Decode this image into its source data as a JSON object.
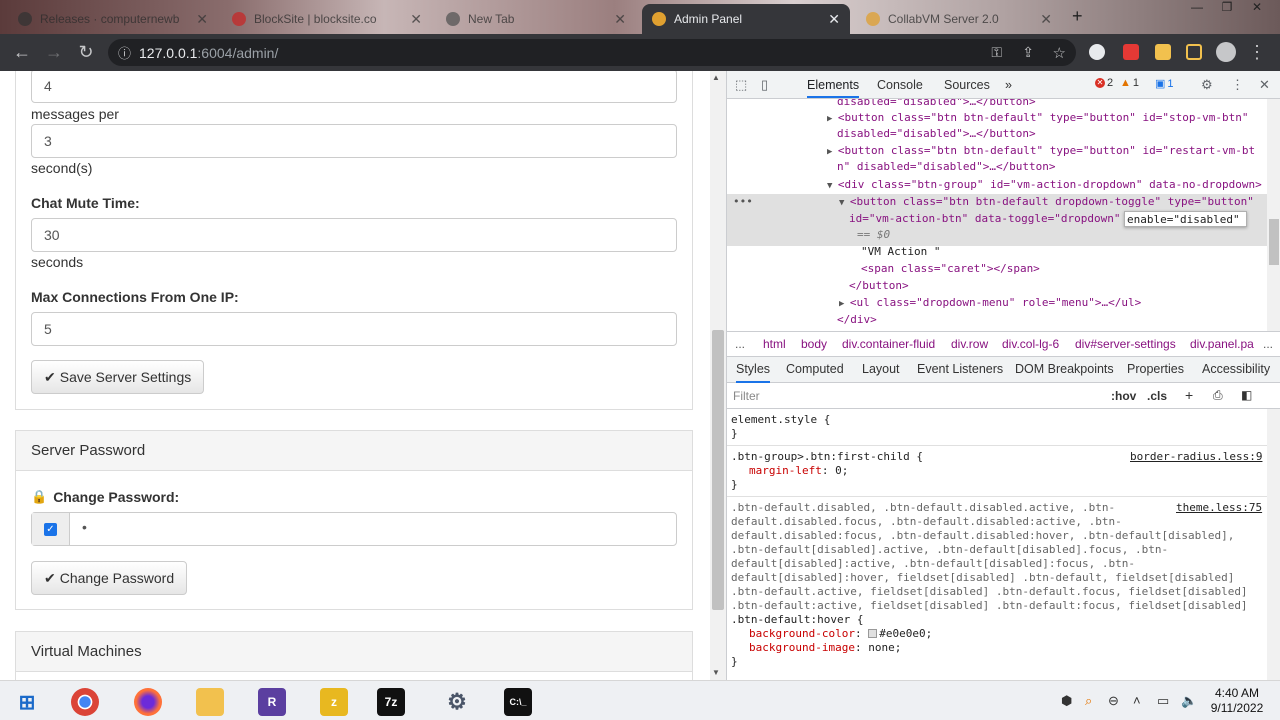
{
  "browser": {
    "tabs": [
      {
        "label": "Releases · computernewb",
        "active": false
      },
      {
        "label": "BlockSite | blocksite.co",
        "active": false
      },
      {
        "label": "New Tab",
        "active": false
      },
      {
        "label": "Admin Panel",
        "active": true
      },
      {
        "label": "CollabVM Server 2.0",
        "active": false
      }
    ],
    "new_tab": "+",
    "url_host": "127.0.0.1",
    "url_rest": ":6004/admin/"
  },
  "page": {
    "first_value": "4",
    "messages_per_label": "messages per",
    "messages_per_value": "3",
    "seconds_label_1": "second(s)",
    "chat_mute_label": "Chat Mute Time:",
    "chat_mute_value": "30",
    "seconds_label_2": "seconds",
    "max_conn_label": "Max Connections From One IP:",
    "max_conn_value": "5",
    "save_button": "Save Server Settings",
    "password_panel_title": "Server Password",
    "change_password_label": "Change Password:",
    "password_value": "•",
    "change_password_button": "Change Password",
    "vm_panel_title": "Virtual Machines"
  },
  "devtools": {
    "tabs": [
      "Elements",
      "Console",
      "Sources"
    ],
    "more": "»",
    "errors": "2",
    "warnings": "1",
    "messages": "1",
    "elements_lines": [
      {
        "t": "disabled=\"disabled\">…</button>"
      },
      {
        "t": "<button class=\"btn btn-default\" type=\"button\" id=\"stop-vm-btn\""
      },
      {
        "t": "disabled=\"disabled\">…</button>"
      },
      {
        "t": "<button class=\"btn btn-default\" type=\"button\" id=\"restart-vm-bt"
      },
      {
        "t": "n\" disabled=\"disabled\">…</button>"
      },
      {
        "t": "<div class=\"btn-group\" id=\"vm-action-dropdown\" data-no-dropdown>"
      },
      {
        "t": "<button class=\"btn btn-default dropdown-toggle\" type=\"button\""
      },
      {
        "t": "id=\"vm-action-btn\" data-toggle=\"dropdown\""
      },
      {
        "t": "== $0"
      },
      {
        "t": "\"VM Action \""
      },
      {
        "t": "<span class=\"caret\"></span>"
      },
      {
        "t": "</button>"
      },
      {
        "t": "<ul class=\"dropdown-menu\" role=\"menu\">…</ul>"
      },
      {
        "t": "</div>"
      }
    ],
    "edit_text": "enable=\"disabled\"",
    "breadcrumbs": [
      "...",
      "html",
      "body",
      "div.container-fluid",
      "div.row",
      "div.col-lg-6",
      "div#server-settings",
      "div.panel.pa",
      "..."
    ],
    "style_tabs": [
      "Styles",
      "Computed",
      "Layout",
      "Event Listeners",
      "DOM Breakpoints",
      "Properties",
      "Accessibility"
    ],
    "filter_placeholder": "Filter",
    "hov": ":hov",
    "cls": ".cls",
    "styles": {
      "element_style": "element.style {",
      "close": "}",
      "rule1_selector": ".btn-group>.btn:first-child {",
      "rule1_source": "border-radius.less:9",
      "rule1_prop": "margin-left",
      "rule1_val": "0;",
      "rule2_source": "theme.less:75",
      "rule2_selector_lines": [
        ".btn-default.disabled, .btn-default.disabled.active, .btn-",
        "default.disabled.focus, .btn-default.disabled:active, .btn-",
        "default.disabled:focus, .btn-default.disabled:hover, .btn-default[disabled],",
        ".btn-default[disabled].active, .btn-default[disabled].focus, .btn-",
        "default[disabled]:active, .btn-default[disabled]:focus, .btn-",
        "default[disabled]:hover, fieldset[disabled] .btn-default, fieldset[disabled]",
        ".btn-default.active, fieldset[disabled] .btn-default.focus, fieldset[disabled]",
        ".btn-default:active, fieldset[disabled] .btn-default:focus, fieldset[disabled]",
        ".btn-default:hover {"
      ],
      "rule2_prop1": "background-color",
      "rule2_val1": "#e0e0e0;",
      "rule2_prop2": "background-image",
      "rule2_val2": "none;"
    }
  },
  "taskbar": {
    "time": "4:40 AM",
    "date": "9/11/2022"
  },
  "colors": {
    "accent": "#1a73e8",
    "checkbox": "#1a73e8"
  }
}
